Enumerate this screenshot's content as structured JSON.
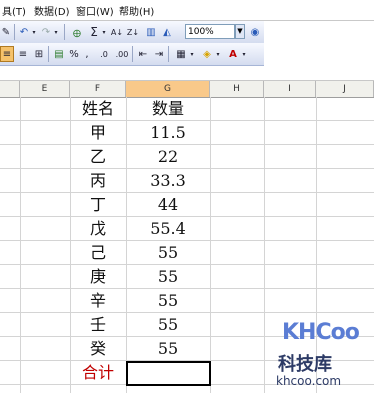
{
  "menu": [
    "具(T)",
    "数据(D)",
    "窗口(W)",
    "帮助(H)"
  ],
  "toolbar": {
    "zoom": "100%"
  },
  "columns": [
    "E",
    "F",
    "G",
    "H",
    "I",
    "J"
  ],
  "table": {
    "header_name": "姓名",
    "header_value": "数量",
    "rows": [
      {
        "name": "甲",
        "value": "11.5"
      },
      {
        "name": "乙",
        "value": "22"
      },
      {
        "name": "丙",
        "value": "33.3"
      },
      {
        "name": "丁",
        "value": "44"
      },
      {
        "name": "戊",
        "value": "55.4"
      },
      {
        "name": "己",
        "value": "55"
      },
      {
        "name": "庚",
        "value": "55"
      },
      {
        "name": "辛",
        "value": "55"
      },
      {
        "name": "壬",
        "value": "55"
      },
      {
        "name": "癸",
        "value": "55"
      }
    ],
    "total_label": "合计",
    "total_value": ""
  },
  "watermark": {
    "logo": "KHCoo",
    "name": "科技库",
    "url": "khcoo.com"
  }
}
